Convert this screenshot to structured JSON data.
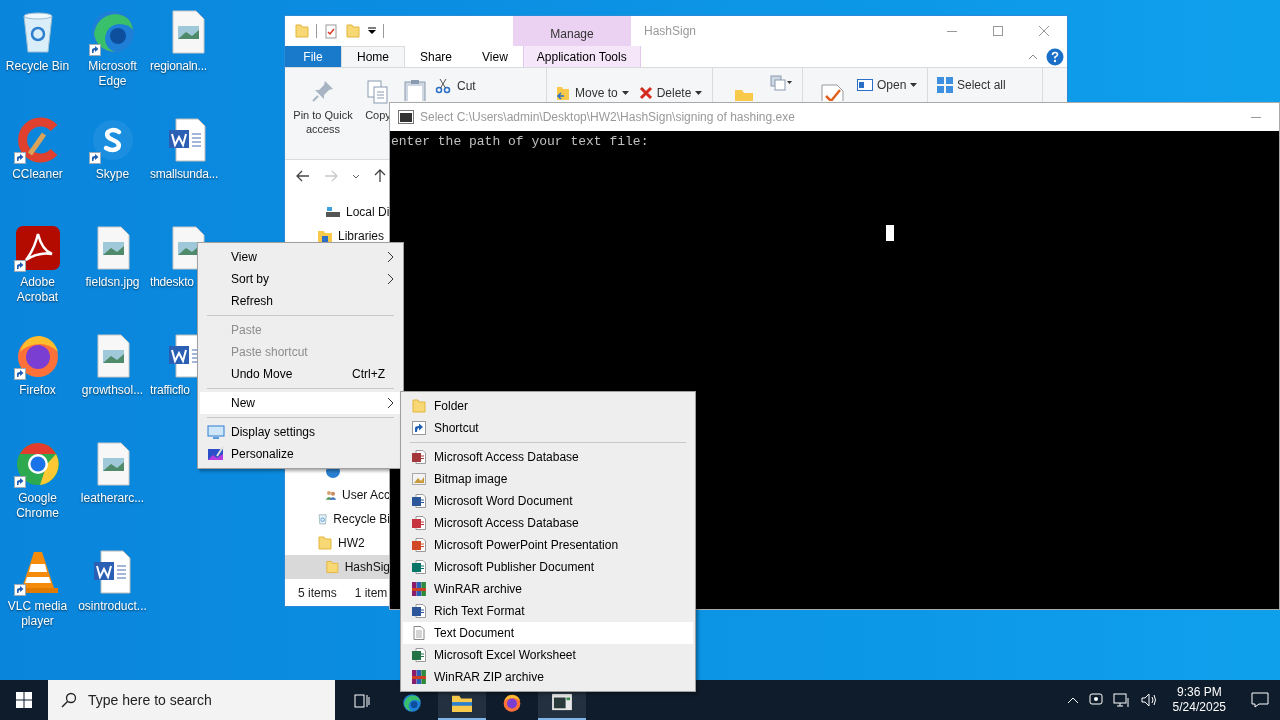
{
  "desktop_icons": [
    [
      {
        "label": "Recycle Bin",
        "kind": "recycle",
        "shortcut": false
      },
      {
        "label": "CCleaner",
        "kind": "ccleaner",
        "shortcut": true
      },
      {
        "label": "Adobe Acrobat",
        "kind": "acrobat",
        "shortcut": true
      },
      {
        "label": "Firefox",
        "kind": "firefox",
        "shortcut": true
      },
      {
        "label": "Google Chrome",
        "kind": "chrome",
        "shortcut": true
      },
      {
        "label": "VLC media player",
        "kind": "vlc",
        "shortcut": true
      }
    ],
    [
      {
        "label": "Microsoft Edge",
        "kind": "edge",
        "shortcut": true
      },
      {
        "label": "Skype",
        "kind": "skype",
        "shortcut": true
      },
      {
        "label": "fieldsn.jpg",
        "kind": "image",
        "shortcut": false
      },
      {
        "label": "growthsol...",
        "kind": "image",
        "shortcut": false
      },
      {
        "label": "leatherarc...",
        "kind": "image",
        "shortcut": false
      },
      {
        "label": "osintroduct...",
        "kind": "word",
        "shortcut": false
      }
    ],
    [
      {
        "label": "regionaln...",
        "kind": "image",
        "shortcut": false
      },
      {
        "label": "smallsunda...",
        "kind": "word",
        "shortcut": false
      },
      {
        "label": "thdeskto",
        "kind": "image",
        "shortcut": false
      },
      {
        "label": "trafficflo",
        "kind": "word",
        "shortcut": false
      }
    ]
  ],
  "explorer": {
    "context_tab": "Manage",
    "title": "HashSign",
    "tabs": [
      {
        "label": "File",
        "kind": "file",
        "selected": false
      },
      {
        "label": "Home",
        "kind": "tab",
        "selected": true
      },
      {
        "label": "Share",
        "kind": "tab",
        "selected": false
      },
      {
        "label": "View",
        "kind": "tab",
        "selected": false
      },
      {
        "label": "Application Tools",
        "kind": "context",
        "selected": false
      }
    ],
    "ribbon": {
      "pin": "Pin to Quick access",
      "copy": "Copy",
      "cut": "Cut",
      "move_to": "Move to",
      "delete": "Delete",
      "open": "Open",
      "select_all": "Select all"
    },
    "tree_top": [
      {
        "label": "Local Di",
        "kind": "drive"
      },
      {
        "label": "Libraries",
        "kind": "libraries"
      }
    ],
    "tree_bottom": [
      {
        "kind": "system"
      },
      {
        "label": "User Acc",
        "kind": "users"
      },
      {
        "label": "Recycle Bi",
        "kind": "recycle"
      },
      {
        "label": "HW2",
        "kind": "folder",
        "selected": false,
        "children": [
          {
            "label": "HashSig",
            "kind": "folder",
            "selected": true
          }
        ]
      }
    ],
    "status": [
      "5 items",
      "1 item"
    ]
  },
  "console": {
    "title": "Select C:\\Users\\admin\\Desktop\\HW2\\HashSign\\signing of hashing.exe",
    "output": "enter the path of your text file:"
  },
  "context_menu": {
    "items": [
      {
        "kind": "item",
        "label": "View",
        "submenu": true,
        "disabled": false,
        "selected": false
      },
      {
        "kind": "item",
        "label": "Sort by",
        "submenu": true,
        "disabled": false,
        "selected": false
      },
      {
        "kind": "item",
        "label": "Refresh",
        "submenu": false,
        "disabled": false,
        "selected": false
      },
      {
        "kind": "separator"
      },
      {
        "kind": "item",
        "label": "Paste",
        "submenu": false,
        "disabled": true,
        "selected": false
      },
      {
        "kind": "item",
        "label": "Paste shortcut",
        "submenu": false,
        "disabled": true,
        "selected": false
      },
      {
        "kind": "item",
        "label": "Undo Move",
        "shortcut": "Ctrl+Z",
        "submenu": false,
        "disabled": false,
        "selected": false
      },
      {
        "kind": "separator"
      },
      {
        "kind": "item",
        "label": "New",
        "submenu": true,
        "disabled": false,
        "selected": true
      },
      {
        "kind": "separator"
      },
      {
        "kind": "display",
        "label": "Display settings",
        "submenu": false,
        "disabled": false,
        "selected": false
      },
      {
        "kind": "personalize",
        "label": "Personalize",
        "submenu": false,
        "disabled": false,
        "selected": false
      }
    ]
  },
  "new_menu": {
    "items": [
      {
        "kind": "folder",
        "label": "Folder",
        "selected": false
      },
      {
        "kind": "shortcut",
        "label": "Shortcut",
        "selected": false
      },
      {
        "kind": "separator"
      },
      {
        "kind": "access",
        "label": "Microsoft Access Database",
        "selected": false
      },
      {
        "kind": "bitmap",
        "label": "Bitmap image",
        "selected": false
      },
      {
        "kind": "word",
        "label": "Microsoft Word Document",
        "selected": false
      },
      {
        "kind": "access_alt",
        "label": "Microsoft Access Database",
        "selected": false
      },
      {
        "kind": "powerpoint",
        "label": "Microsoft PowerPoint Presentation",
        "selected": false
      },
      {
        "kind": "publisher",
        "label": "Microsoft Publisher Document",
        "selected": false
      },
      {
        "kind": "winrar",
        "label": "WinRAR archive",
        "selected": false
      },
      {
        "kind": "rtf",
        "label": "Rich Text Format",
        "selected": false
      },
      {
        "kind": "text",
        "label": "Text Document",
        "selected": true
      },
      {
        "kind": "excel",
        "label": "Microsoft Excel Worksheet",
        "selected": false
      },
      {
        "kind": "winrar",
        "label": "WinRAR ZIP archive",
        "selected": false
      }
    ]
  },
  "taskbar": {
    "search_placeholder": "Type here to search",
    "apps": [
      {
        "kind": "taskview",
        "running": false
      },
      {
        "kind": "edge",
        "running": false
      },
      {
        "kind": "explorer",
        "running": true
      },
      {
        "kind": "firefox",
        "running": false
      },
      {
        "kind": "console",
        "running": true
      }
    ],
    "time": "9:36 PM",
    "date": "5/24/2025"
  }
}
